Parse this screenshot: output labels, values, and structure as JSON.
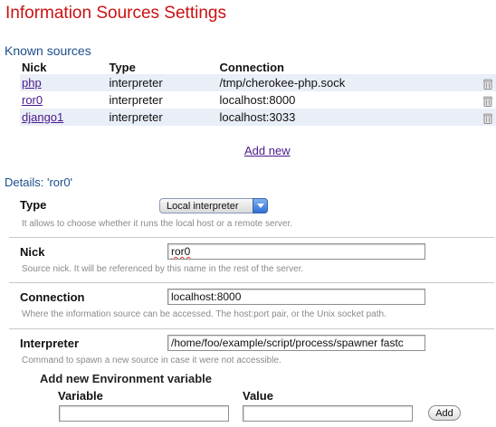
{
  "page": {
    "title": "Information Sources Settings"
  },
  "known_sources": {
    "heading": "Known sources",
    "columns": [
      "Nick",
      "Type",
      "Connection"
    ],
    "rows": [
      {
        "nick": "php",
        "type": "interpreter",
        "connection": "/tmp/cherokee-php.sock"
      },
      {
        "nick": "ror0",
        "type": "interpreter",
        "connection": "localhost:8000"
      },
      {
        "nick": "django1",
        "type": "interpreter",
        "connection": "localhost:3033"
      }
    ],
    "delete_icon": "trash-icon",
    "add_new_label": "Add new"
  },
  "details": {
    "heading": "Details: 'ror0'",
    "type": {
      "label": "Type",
      "selected": "Local interpreter",
      "help": "It allows to choose whether it runs the local host or a remote server."
    },
    "nick": {
      "label": "Nick",
      "value": "ror0",
      "help": "Source nick. It will be referenced by this name in the rest of the server."
    },
    "connection": {
      "label": "Connection",
      "value": "localhost:8000",
      "help": "Where the information source can be accessed. The host:port pair, or the Unix socket path."
    },
    "interpreter": {
      "label": "Interpreter",
      "value": "/home/foo/example/script/process/spawner fastc",
      "help": "Command to spawn a new source in case it were not accessible."
    }
  },
  "env": {
    "heading": "Add new Environment variable",
    "variable_label": "Variable",
    "value_label": "Value",
    "variable_value": "",
    "value_value": "",
    "add_button": "Add"
  },
  "colors": {
    "title": "#cc1111",
    "section_heading": "#1d4c8c",
    "link": "#4a1a8a",
    "row_alt": "#e9eef7",
    "help_text": "#8a8a8a"
  }
}
